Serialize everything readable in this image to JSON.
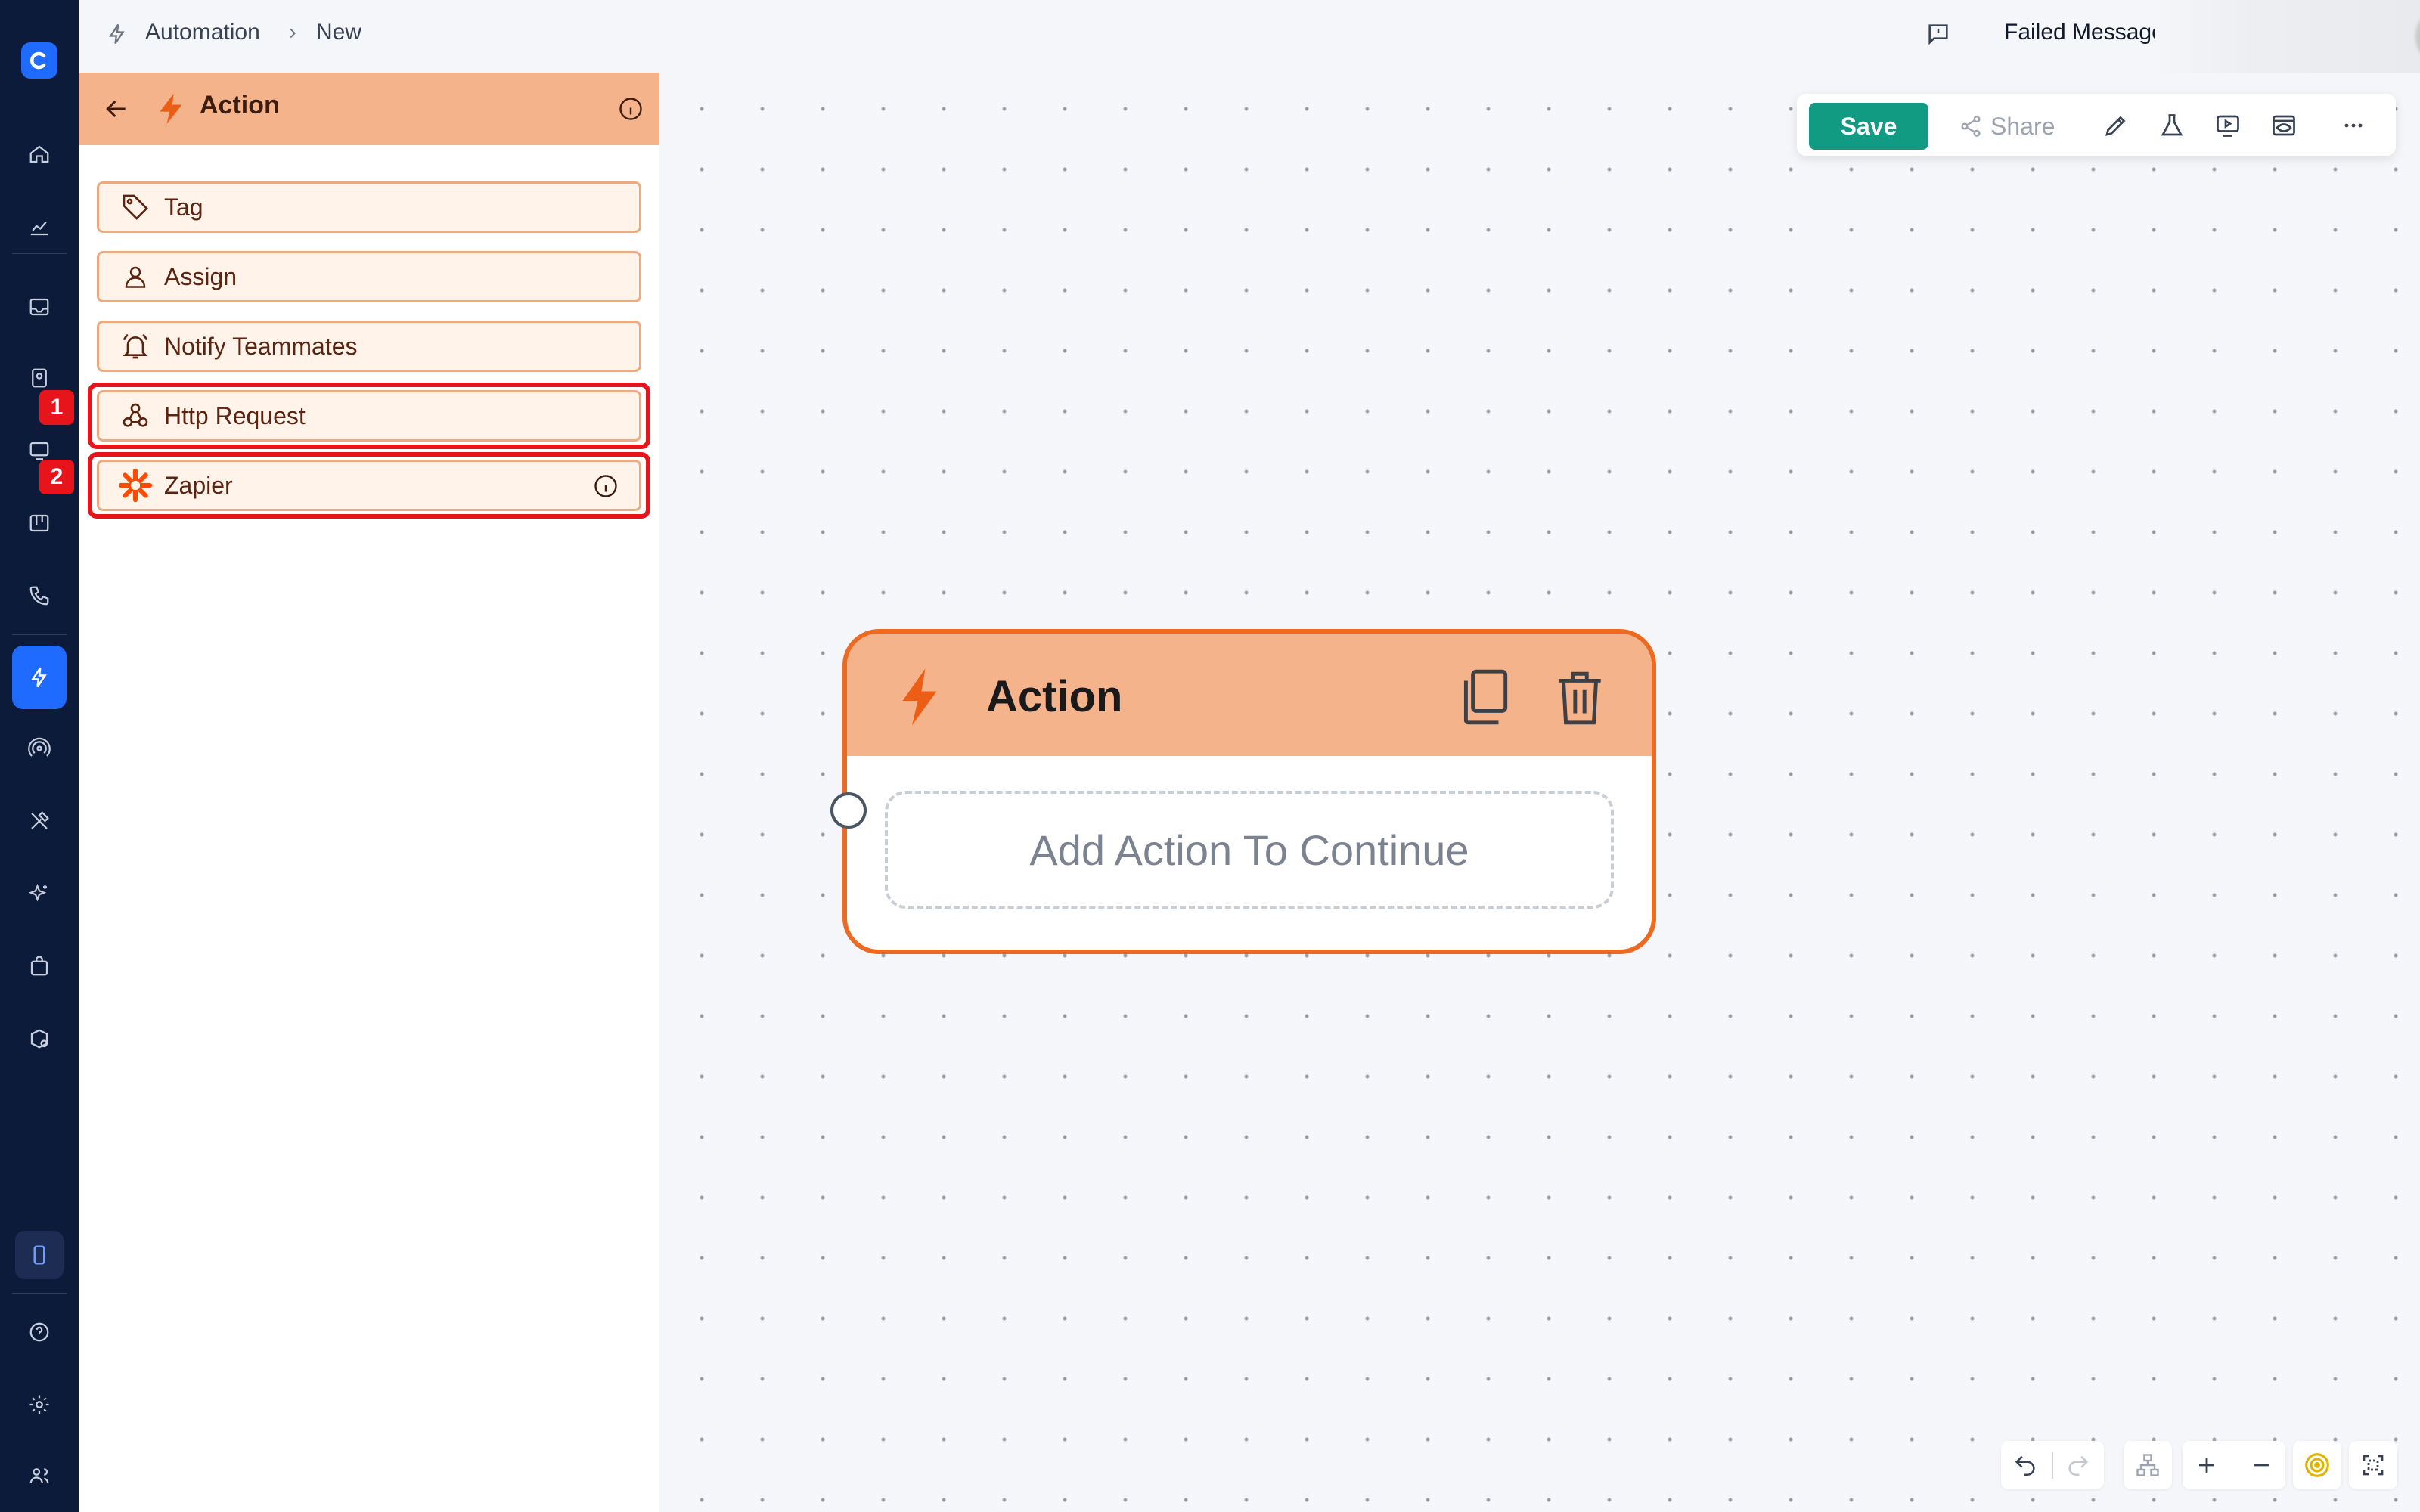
{
  "breadcrumb": {
    "section": "Automation",
    "current": "New"
  },
  "topbar": {
    "failed_messages_label": "Failed Messages"
  },
  "rail": {
    "badges": [
      "1",
      "2"
    ]
  },
  "panel": {
    "title": "Action",
    "items": [
      {
        "label": "Tag",
        "icon": "tag-icon"
      },
      {
        "label": "Assign",
        "icon": "user-icon"
      },
      {
        "label": "Notify Teammates",
        "icon": "bell-icon"
      },
      {
        "label": "Http Request",
        "icon": "webhook-icon"
      },
      {
        "label": "Zapier",
        "icon": "zapier-icon"
      }
    ]
  },
  "toolbar": {
    "save_label": "Save",
    "share_label": "Share"
  },
  "node": {
    "title": "Action",
    "placeholder": "Add Action To Continue"
  },
  "colors": {
    "rail_bg": "#0d1b3a",
    "accent_blue": "#1f6bff",
    "panel_header": "#f5b38c",
    "node_border": "#ec6a22",
    "save_green": "#109b82",
    "highlight_red": "#e8141c"
  }
}
